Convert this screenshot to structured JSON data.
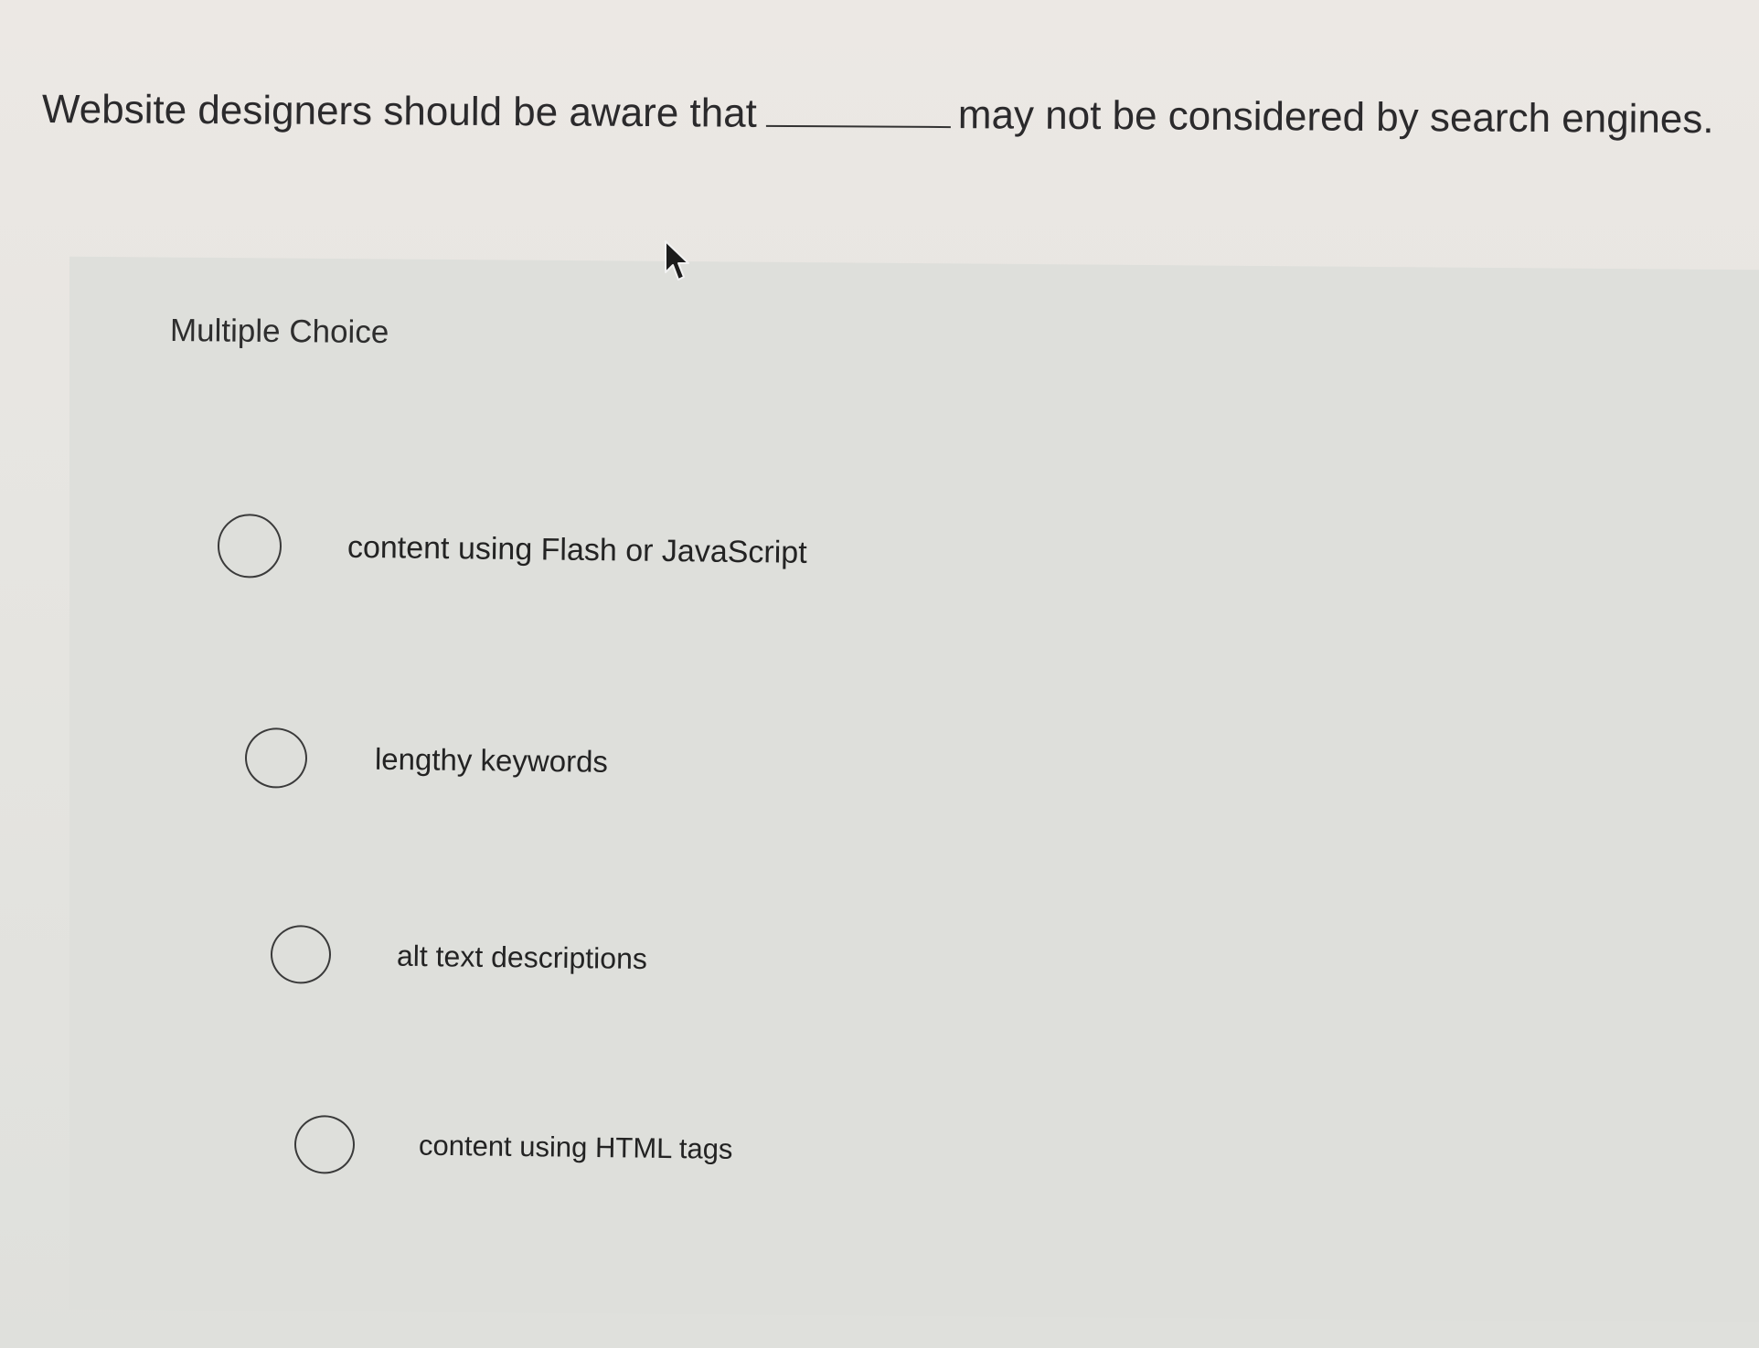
{
  "question": {
    "text_before": "Website designers should be aware that",
    "text_after": "may not be considered by search engines."
  },
  "question_type": "Multiple Choice",
  "choices": [
    {
      "label": "content using Flash or JavaScript"
    },
    {
      "label": "lengthy keywords"
    },
    {
      "label": "alt text descriptions"
    },
    {
      "label": "content using HTML tags"
    }
  ],
  "icons": {
    "cursor": "mouse-pointer-icon"
  }
}
